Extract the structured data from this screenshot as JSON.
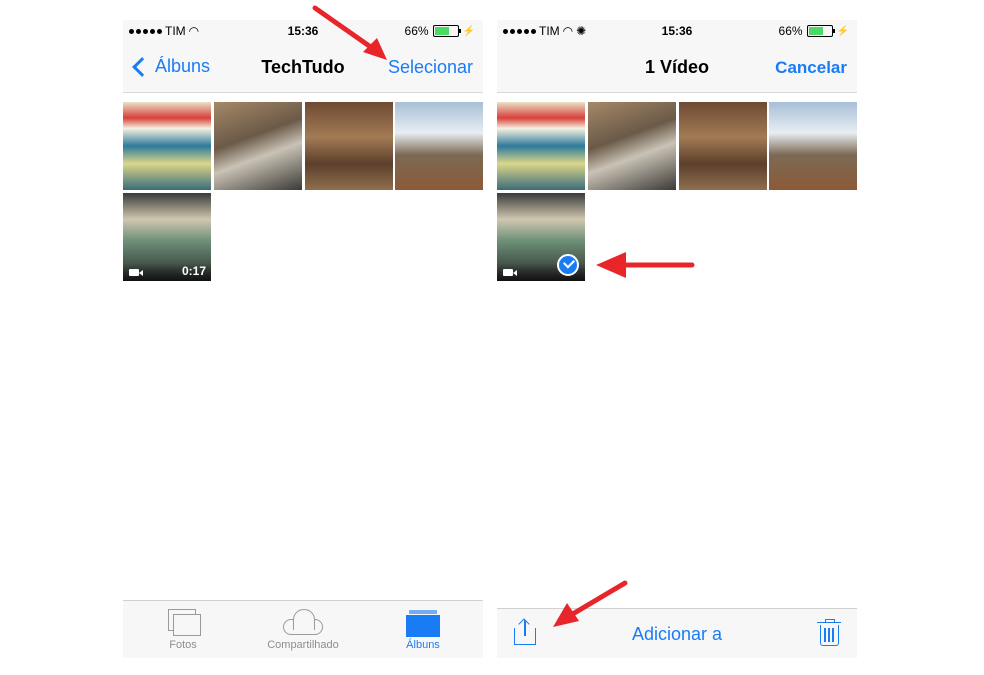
{
  "left": {
    "status": {
      "carrier": "TIM",
      "time": "15:36",
      "battery": "66%",
      "battery_level": 0.66
    },
    "nav": {
      "back_label": "Álbuns",
      "title": "TechTudo",
      "action_label": "Selecionar"
    },
    "video_duration": "0:17",
    "tabs": [
      {
        "label": "Fotos",
        "icon": "photos-icon"
      },
      {
        "label": "Compartilhado",
        "icon": "cloud-icon"
      },
      {
        "label": "Álbuns",
        "icon": "albums-icon",
        "selected": true
      }
    ]
  },
  "right": {
    "status": {
      "carrier": "TIM",
      "time": "15:36",
      "battery": "66%",
      "battery_level": 0.66
    },
    "nav": {
      "title": "1 Vídeo",
      "action_label": "Cancelar"
    },
    "toolbar": {
      "add_label": "Adicionar a"
    }
  },
  "colors": {
    "accent": "#1a7cf5",
    "annotation_arrow": "#e8262a",
    "bars": "#f7f7f7"
  }
}
